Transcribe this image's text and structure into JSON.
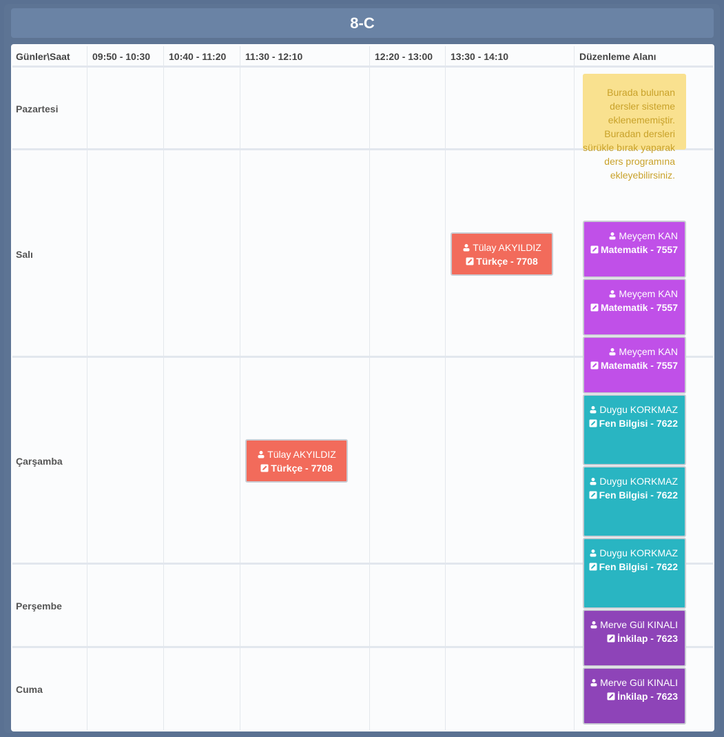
{
  "title": "8-C",
  "headers": [
    "Günler\\Saat",
    "09:50 - 10:30",
    "10:40 - 11:20",
    "11:30 - 12:10",
    "12:20 - 13:00",
    "13:30 - 14:10",
    "Düzenleme Alanı"
  ],
  "days": [
    "Pazartesi",
    "Salı",
    "Çarşamba",
    "Perşembe",
    "Cuma"
  ],
  "note": "Burada bulunan dersler sisteme eklenememiştir. Buradan dersleri sürükle bırak yaparak ders programına ekleyebilirsiniz.",
  "scheduled": [
    {
      "teacher": "Tülay AKYILDIZ",
      "subject": "Türkçe - 7708",
      "day": "Salı",
      "slot": "13:30 - 14:10"
    },
    {
      "teacher": "Tülay AKYILDIZ",
      "subject": "Türkçe - 7708",
      "day": "Çarşamba",
      "slot": "11:30 - 12:10"
    }
  ],
  "pending": [
    {
      "teacher": "Meyçem KAN",
      "subject": "Matematik - 7557"
    },
    {
      "teacher": "Meyçem KAN",
      "subject": "Matematik - 7557"
    },
    {
      "teacher": "Meyçem KAN",
      "subject": "Matematik - 7557"
    },
    {
      "teacher": "Duygu KORKMAZ",
      "subject": "Fen Bilgisi - 7622"
    },
    {
      "teacher": "Duygu KORKMAZ",
      "subject": "Fen Bilgisi - 7622"
    },
    {
      "teacher": "Duygu KORKMAZ",
      "subject": "Fen Bilgisi - 7622"
    },
    {
      "teacher": "Merve Gül KINALI",
      "subject": "İnkilap - 7623"
    },
    {
      "teacher": "Merve Gül KINALI",
      "subject": "İnkilap - 7623"
    }
  ],
  "colors": {
    "turkce": "#f26b5b",
    "matematik": "#c050e8",
    "fen": "#29b5c2",
    "inkilap": "#8e44b8",
    "note_bg": "#f9e18f",
    "note_text": "#c9a22a",
    "frame": "#5d7494",
    "title_bar": "#6a83a5"
  },
  "icons": {
    "teacher": "user-group-icon",
    "subject": "edit-icon"
  }
}
